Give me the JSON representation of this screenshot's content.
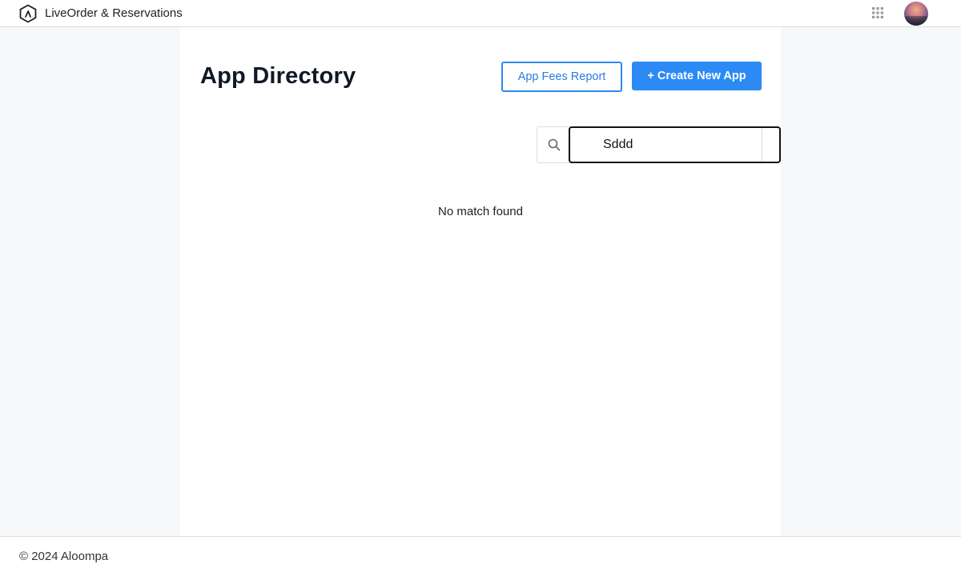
{
  "header": {
    "app_name": "LiveOrder & Reservations",
    "logo_icon": "hexagon-logo-icon",
    "apps_icon": "apps-grid-icon",
    "avatar": "user-avatar"
  },
  "main": {
    "title": "App Directory",
    "fees_button_label": "App Fees Report",
    "create_button_label": "+ Create New App",
    "search": {
      "icon": "search-icon",
      "value": "Sddd"
    },
    "empty_message": "No match found"
  },
  "footer": {
    "copyright": "© 2024 Aloompa"
  },
  "colors": {
    "accent": "#2b8af3",
    "page_background": "#f7f8fa",
    "panel_background": "#ffffff"
  }
}
